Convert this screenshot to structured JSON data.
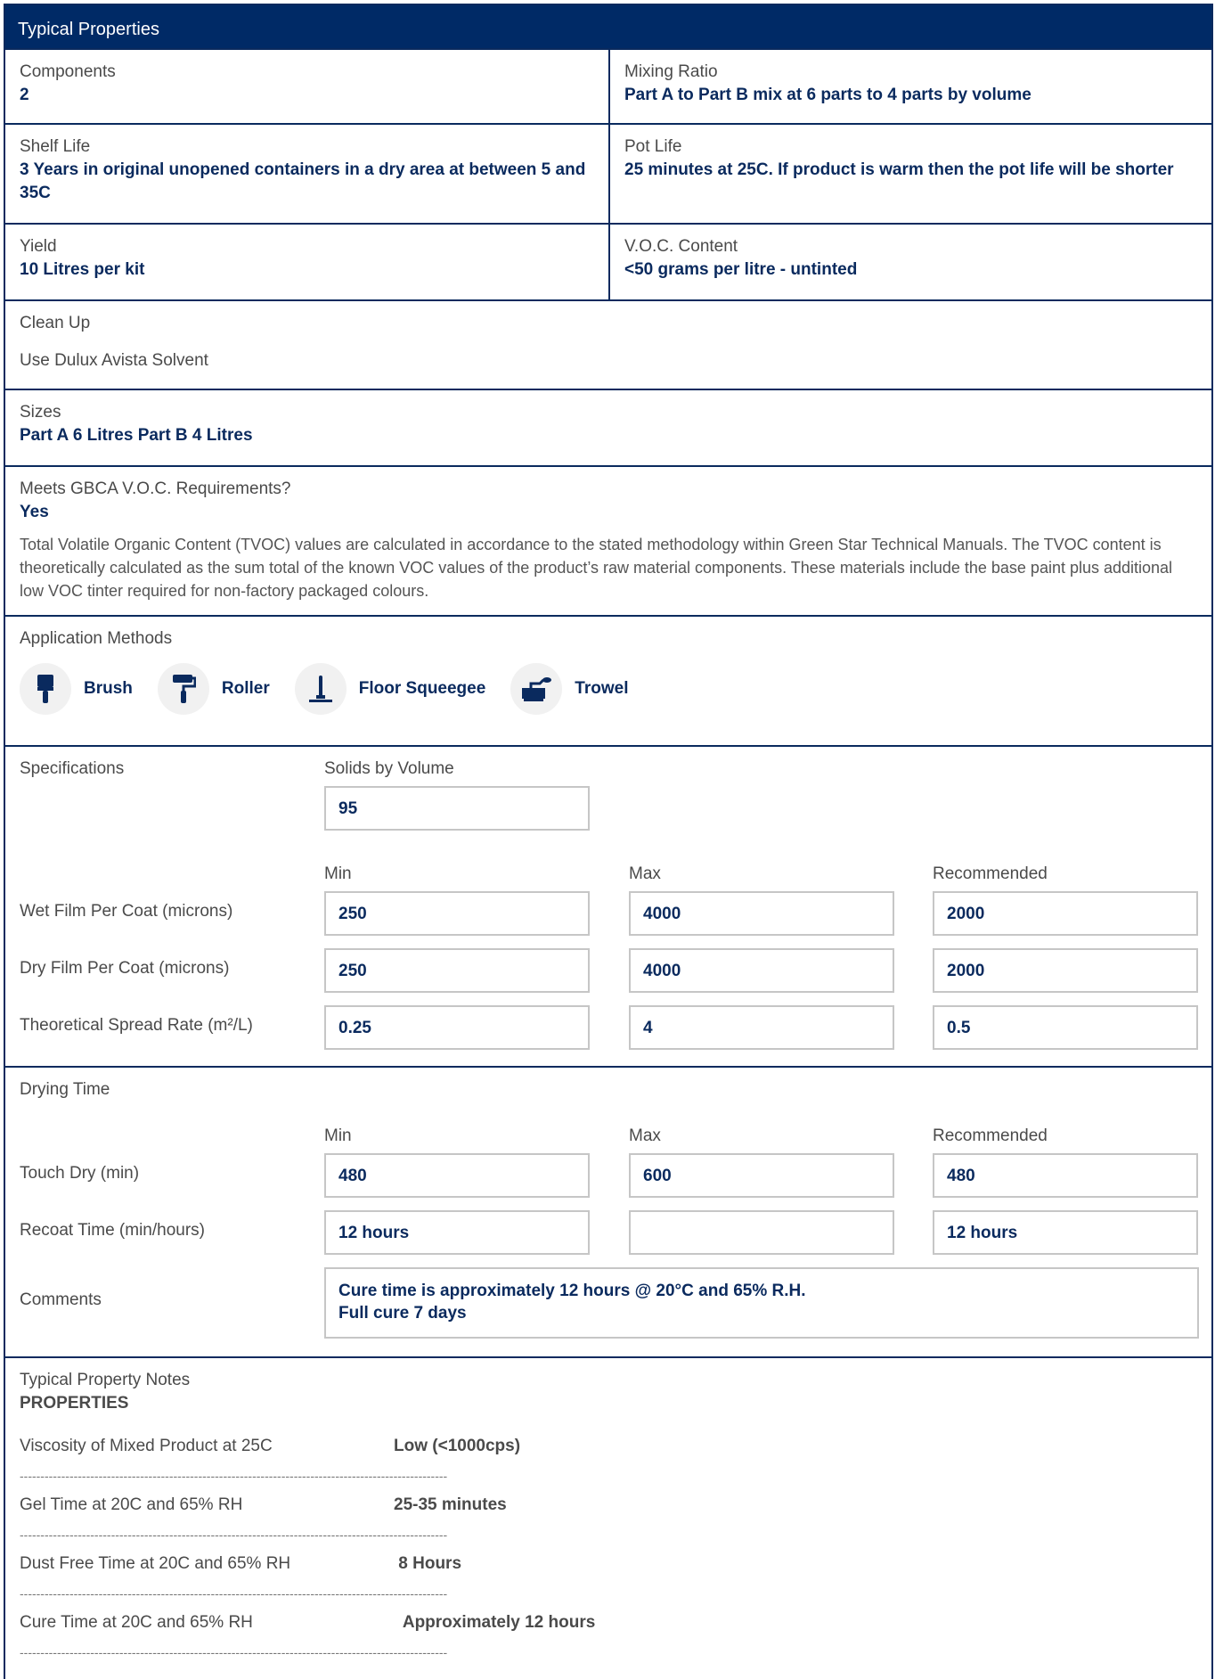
{
  "title": "Typical Properties",
  "components": {
    "label": "Components",
    "value": "2"
  },
  "mixing_ratio": {
    "label": "Mixing Ratio",
    "value": "Part A to Part B mix at 6 parts to 4 parts by volume"
  },
  "shelf_life": {
    "label": "Shelf Life",
    "value": "3 Years in original unopened containers in a dry area at between 5 and 35C"
  },
  "pot_life": {
    "label": "Pot Life",
    "value": "25 minutes at 25C. If product is warm then the pot life will be shorter"
  },
  "yield": {
    "label": "Yield",
    "value": "10 Litres per kit"
  },
  "voc": {
    "label": "V.O.C. Content",
    "value": "<50 grams per litre - untinted"
  },
  "clean_up": {
    "label": "Clean Up",
    "value": "Use Dulux Avista Solvent"
  },
  "sizes": {
    "label": "Sizes",
    "value": "Part A 6 Litres Part B 4 Litres"
  },
  "gbca": {
    "label": "Meets GBCA V.O.C. Requirements?",
    "value": "Yes",
    "note": "Total Volatile Organic Content (TVOC) values are calculated in accordance to the stated methodology within Green Star Technical Manuals. The TVOC content is theoretically calculated as the sum total of the known VOC values of the product’s raw material components. These materials include the base paint plus additional low VOC tinter required for non-factory packaged colours."
  },
  "application": {
    "label": "Application Methods",
    "methods": [
      {
        "label": "Brush",
        "icon": "brush-icon"
      },
      {
        "label": "Roller",
        "icon": "roller-icon"
      },
      {
        "label": "Floor Squeegee",
        "icon": "squeegee-icon"
      },
      {
        "label": "Trowel",
        "icon": "trowel-icon"
      }
    ]
  },
  "specs": {
    "label": "Specifications",
    "solids_label": "Solids by Volume",
    "solids_value": "95",
    "col_min": "Min",
    "col_max": "Max",
    "col_rec": "Recommended",
    "rows": [
      {
        "label": "Wet Film Per Coat (microns)",
        "min": "250",
        "max": "4000",
        "rec": "2000"
      },
      {
        "label": "Dry Film Per Coat (microns)",
        "min": "250",
        "max": "4000",
        "rec": "2000"
      },
      {
        "label": "Theoretical Spread Rate (m²/L)",
        "min": "0.25",
        "max": "4",
        "rec": "0.5"
      }
    ]
  },
  "drying": {
    "label": "Drying Time",
    "col_min": "Min",
    "col_max": "Max",
    "col_rec": "Recommended",
    "rows": [
      {
        "label": "Touch Dry (min)",
        "min": "480",
        "max": "600",
        "rec": "480"
      },
      {
        "label": "Recoat Time (min/hours)",
        "min": "12 hours",
        "max": "",
        "rec": "12 hours"
      }
    ],
    "comments_label": "Comments",
    "comments_line1": "Cure time is approximately 12 hours @ 20°C and 65% R.H.",
    "comments_line2": "Full cure 7 days"
  },
  "notes": {
    "label": "Typical Property Notes",
    "heading": "PROPERTIES",
    "rows": [
      {
        "key": "Viscosity of Mixed Product at 25C",
        "value": "Low (<1000cps)"
      },
      {
        "key": "Gel Time at 20C and 65% RH",
        "value": "25-35 minutes"
      },
      {
        "key": "Dust Free Time at 20C and 65% RH",
        "value": " 8 Hours"
      },
      {
        "key": "Cure Time at 20C and 65% RH",
        "value": "  Approximately 12 hours"
      }
    ],
    "separator": "-------------------------------------------------------------------------------------------------------"
  },
  "colors": {
    "navy": "#002a66",
    "border": "#0a2a5e",
    "value_text": "#0a2a5e",
    "box_border": "#c6c6c6"
  }
}
